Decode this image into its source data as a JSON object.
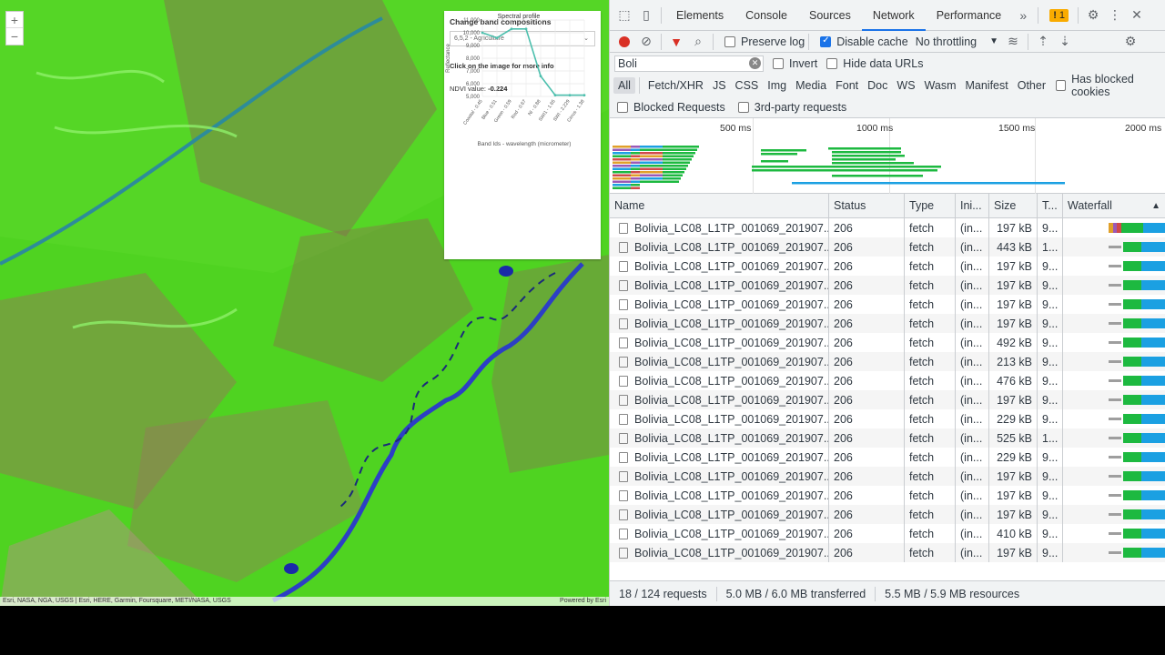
{
  "map": {
    "zoom_in": "+",
    "zoom_out": "−",
    "attribution_left": "Esri, NASA, NGA, USGS | Esri, HERE, Garmin, Foursquare, METI/NASA, USGS",
    "attribution_right": "Powered by Esri",
    "panel": {
      "title": "Change band compositions",
      "selected_option": "6,5,2 - Agriculture",
      "info_text": "Click on the image for more info",
      "ndvi_label": "NDVI value:",
      "ndvi_value": "-0.224"
    }
  },
  "chart_data": {
    "type": "line",
    "title": "Spectral profile",
    "xlabel": "Band Ids - wavelength (micrometer)",
    "ylabel": "Reflectance",
    "categories": [
      "Coastal - 0.45",
      "Blue - 0.51",
      "Green - 0.59",
      "Red - 0.67",
      "NI - 0.88",
      "SWI1 - 1.65",
      "SWI - 2.229",
      "Cirrus - 1.38"
    ],
    "values": [
      10000,
      9600,
      10300,
      10300,
      6600,
      5100,
      5100,
      5100
    ],
    "yticks": [
      "11,000",
      "10,000",
      "9,000",
      "8,000",
      "7,000",
      "6,000",
      "5,000"
    ],
    "ylim": [
      5000,
      11000
    ],
    "grid": true,
    "color": "#4cbfad"
  },
  "devtools": {
    "tabs": [
      "Elements",
      "Console",
      "Sources",
      "Network",
      "Performance"
    ],
    "active_tab": "Network",
    "more": "»",
    "issues_count": "1",
    "toolbar": {
      "preserve_log": "Preserve log",
      "disable_cache": "Disable cache",
      "throttling": "No throttling"
    },
    "filter_value": "Boli",
    "invert": "Invert",
    "hide_data_urls": "Hide data URLs",
    "types": [
      "All",
      "Fetch/XHR",
      "JS",
      "CSS",
      "Img",
      "Media",
      "Font",
      "Doc",
      "WS",
      "Wasm",
      "Manifest",
      "Other"
    ],
    "has_blocked_cookies": "Has blocked cookies",
    "blocked_requests": "Blocked Requests",
    "third_party": "3rd-party requests",
    "timeline_ticks": [
      "500 ms",
      "1000 ms",
      "1500 ms",
      "2000 ms"
    ],
    "columns": [
      "Name",
      "Status",
      "Type",
      "Ini...",
      "Size",
      "T...",
      "Waterfall"
    ],
    "rows": [
      {
        "name": "Bolivia_LC08_L1TP_001069_201907...",
        "status": "206",
        "type": "fetch",
        "init": "(in...",
        "size": "197 kB",
        "time": "9..."
      },
      {
        "name": "Bolivia_LC08_L1TP_001069_201907...",
        "status": "206",
        "type": "fetch",
        "init": "(in...",
        "size": "443 kB",
        "time": "1..."
      },
      {
        "name": "Bolivia_LC08_L1TP_001069_201907...",
        "status": "206",
        "type": "fetch",
        "init": "(in...",
        "size": "197 kB",
        "time": "9..."
      },
      {
        "name": "Bolivia_LC08_L1TP_001069_201907...",
        "status": "206",
        "type": "fetch",
        "init": "(in...",
        "size": "197 kB",
        "time": "9..."
      },
      {
        "name": "Bolivia_LC08_L1TP_001069_201907...",
        "status": "206",
        "type": "fetch",
        "init": "(in...",
        "size": "197 kB",
        "time": "9..."
      },
      {
        "name": "Bolivia_LC08_L1TP_001069_201907...",
        "status": "206",
        "type": "fetch",
        "init": "(in...",
        "size": "197 kB",
        "time": "9..."
      },
      {
        "name": "Bolivia_LC08_L1TP_001069_201907...",
        "status": "206",
        "type": "fetch",
        "init": "(in...",
        "size": "492 kB",
        "time": "9..."
      },
      {
        "name": "Bolivia_LC08_L1TP_001069_201907...",
        "status": "206",
        "type": "fetch",
        "init": "(in...",
        "size": "213 kB",
        "time": "9..."
      },
      {
        "name": "Bolivia_LC08_L1TP_001069_201907...",
        "status": "206",
        "type": "fetch",
        "init": "(in...",
        "size": "476 kB",
        "time": "9..."
      },
      {
        "name": "Bolivia_LC08_L1TP_001069_201907...",
        "status": "206",
        "type": "fetch",
        "init": "(in...",
        "size": "197 kB",
        "time": "9..."
      },
      {
        "name": "Bolivia_LC08_L1TP_001069_201907...",
        "status": "206",
        "type": "fetch",
        "init": "(in...",
        "size": "229 kB",
        "time": "9..."
      },
      {
        "name": "Bolivia_LC08_L1TP_001069_201907...",
        "status": "206",
        "type": "fetch",
        "init": "(in...",
        "size": "525 kB",
        "time": "1..."
      },
      {
        "name": "Bolivia_LC08_L1TP_001069_201907...",
        "status": "206",
        "type": "fetch",
        "init": "(in...",
        "size": "229 kB",
        "time": "9..."
      },
      {
        "name": "Bolivia_LC08_L1TP_001069_201907...",
        "status": "206",
        "type": "fetch",
        "init": "(in...",
        "size": "197 kB",
        "time": "9..."
      },
      {
        "name": "Bolivia_LC08_L1TP_001069_201907...",
        "status": "206",
        "type": "fetch",
        "init": "(in...",
        "size": "197 kB",
        "time": "9..."
      },
      {
        "name": "Bolivia_LC08_L1TP_001069_201907...",
        "status": "206",
        "type": "fetch",
        "init": "(in...",
        "size": "197 kB",
        "time": "9..."
      },
      {
        "name": "Bolivia_LC08_L1TP_001069_201907...",
        "status": "206",
        "type": "fetch",
        "init": "(in...",
        "size": "410 kB",
        "time": "9..."
      },
      {
        "name": "Bolivia_LC08_L1TP_001069_201907...",
        "status": "206",
        "type": "fetch",
        "init": "(in...",
        "size": "197 kB",
        "time": "9..."
      }
    ],
    "status_bar": {
      "requests": "18 / 124 requests",
      "transferred": "5.0 MB / 6.0 MB transferred",
      "resources": "5.5 MB / 5.9 MB resources"
    },
    "colors": {
      "accent": "#1a73e8",
      "record": "#d93025",
      "waterfall_green": "#1db940",
      "waterfall_blue": "#1ba0e2"
    }
  }
}
